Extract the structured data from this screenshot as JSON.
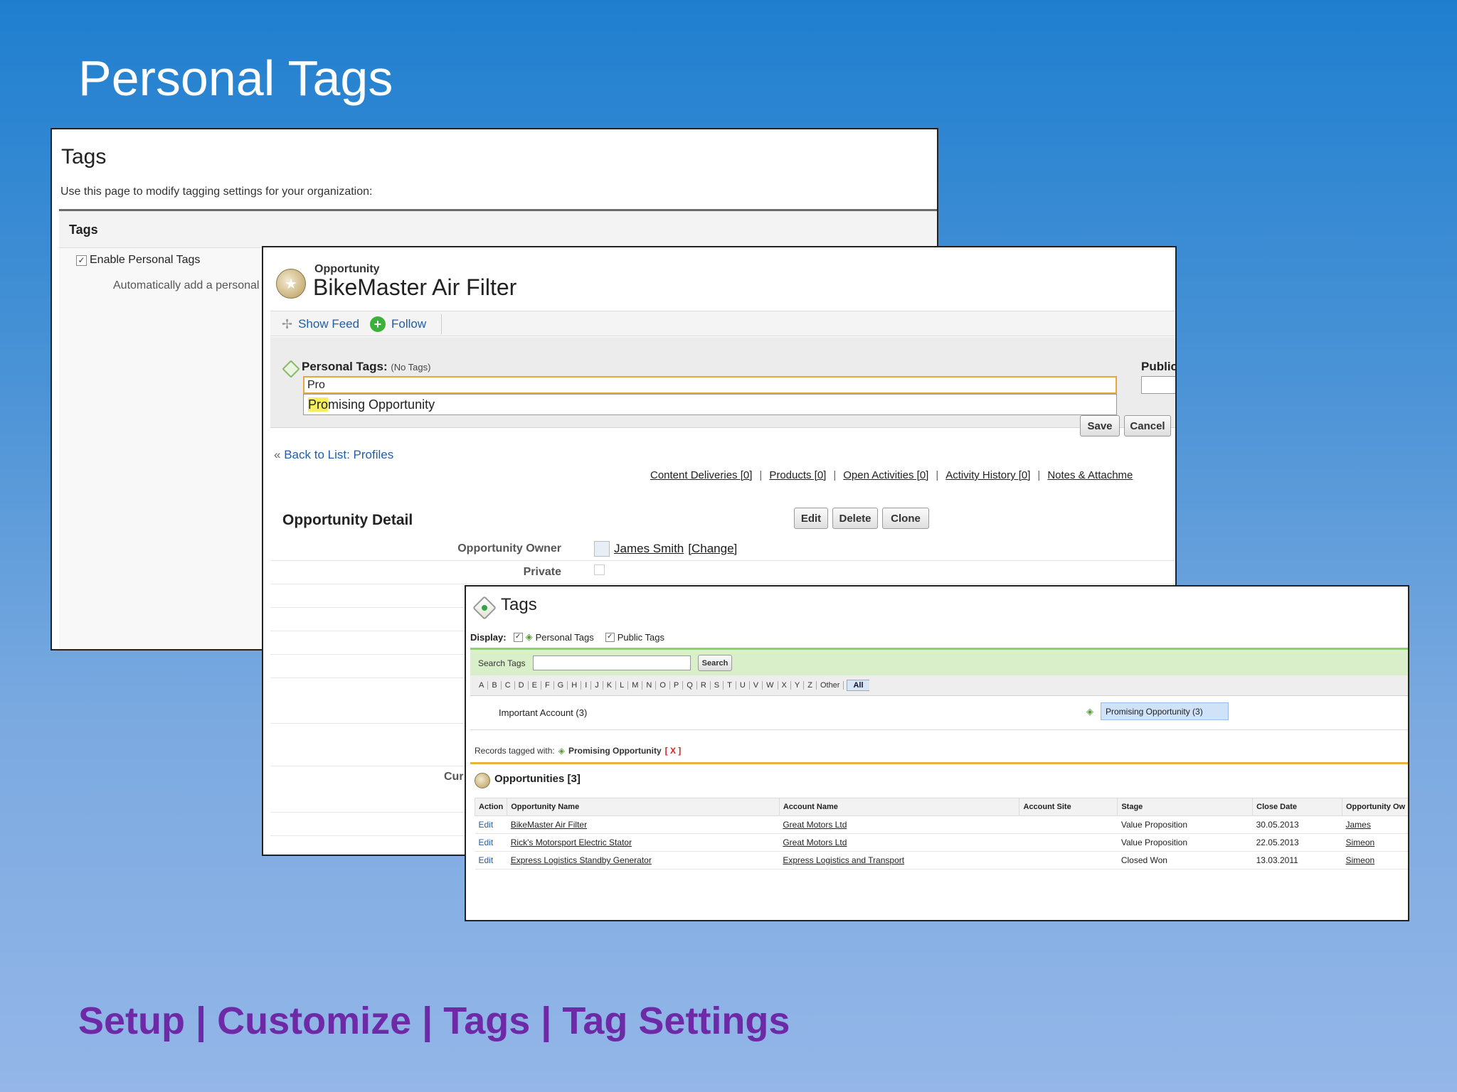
{
  "slide": {
    "title": "Personal Tags",
    "footer": "Setup | Customize | Tags | Tag Settings"
  },
  "settings": {
    "heading": "Tags",
    "description": "Use this page to modify tagging settings for your organization:",
    "section_title": "Tags",
    "enable_label": "Enable Personal Tags",
    "auto_text": "Automatically add a personal t"
  },
  "opportunity": {
    "type_label": "Opportunity",
    "name": "BikeMaster Air Filter",
    "show_feed": "Show Feed",
    "follow": "Follow",
    "personal_tags_label": "Personal Tags:",
    "no_tags": "(No Tags)",
    "input_value": "Pro",
    "suggestion_match": "Pro",
    "suggestion_rest": "mising Opportunity",
    "public_label": "Public",
    "save": "Save",
    "cancel": "Cancel",
    "back_to_list": "Back to List: Profiles",
    "related_links": [
      "Content Deliveries [0]",
      "Products [0]",
      "Open Activities [0]",
      "Activity History [0]",
      "Notes & Attachme"
    ],
    "detail_title": "Opportunity Detail",
    "buttons": [
      "Edit",
      "Delete",
      "Clone"
    ],
    "owner_label": "Opportunity Owner",
    "owner_name": "James Smith",
    "owner_change": "[Change]",
    "private_label": "Private",
    "cut_label": "Cur"
  },
  "tags_browser": {
    "title": "Tags",
    "display_label": "Display:",
    "personal_tags": "Personal Tags",
    "public_tags": "Public Tags",
    "search_label": "Search Tags",
    "search_button": "Search",
    "letters": [
      "A",
      "B",
      "C",
      "D",
      "E",
      "F",
      "G",
      "H",
      "I",
      "J",
      "K",
      "L",
      "M",
      "N",
      "O",
      "P",
      "Q",
      "R",
      "S",
      "T",
      "U",
      "V",
      "W",
      "X",
      "Y",
      "Z",
      "Other"
    ],
    "all_label": "All",
    "tag_important": "Important Account (3)",
    "tag_promising": "Promising Opportunity (3)",
    "records_tagged_label": "Records tagged with:",
    "records_tag": "Promising Opportunity",
    "records_remove": "[ X ]",
    "opps_title": "Opportunities [3]",
    "columns": [
      "Action",
      "Opportunity Name",
      "Account Name",
      "Account Site",
      "Stage",
      "Close Date",
      "Opportunity Ow"
    ],
    "rows": [
      {
        "action": "Edit",
        "name": "BikeMaster Air Filter",
        "account": "Great Motors Ltd",
        "site": "",
        "stage": "Value Proposition",
        "close": "30.05.2013",
        "owner": "James"
      },
      {
        "action": "Edit",
        "name": "Rick's Motorsport Electric Stator",
        "account": "Great Motors Ltd",
        "site": "",
        "stage": "Value Proposition",
        "close": "22.05.2013",
        "owner": "Simeon"
      },
      {
        "action": "Edit",
        "name": "Express Logistics Standby Generator",
        "account": "Express Logistics and Transport",
        "site": "",
        "stage": "Closed Won",
        "close": "13.03.2011",
        "owner": "Simeon"
      }
    ]
  }
}
